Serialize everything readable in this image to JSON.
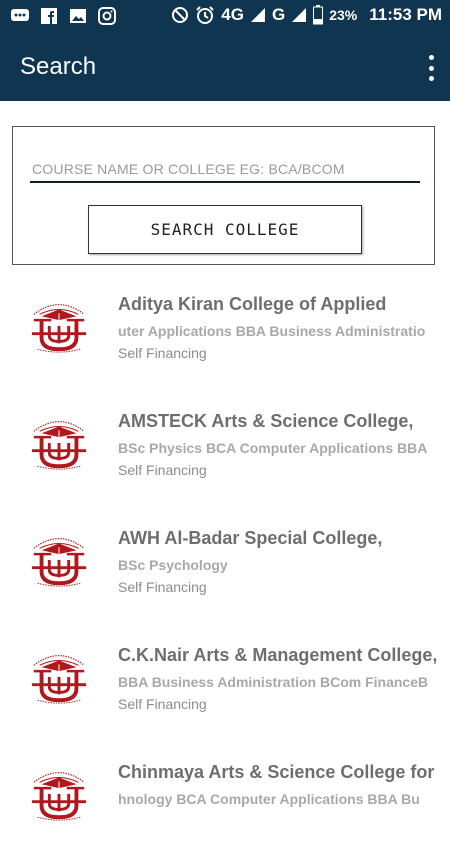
{
  "status_bar": {
    "battery": "23%",
    "time": "11:53 PM",
    "network1": "4G",
    "network2": "G",
    "icons": [
      "messages-icon",
      "facebook-icon",
      "gallery-icon",
      "instagram-icon",
      "do-not-disturb-icon",
      "alarm-icon",
      "signal-icon",
      "battery-icon"
    ]
  },
  "app_bar": {
    "title": "Search",
    "menu_icon": "overflow-menu-icon"
  },
  "search": {
    "placeholder": "COURSE NAME OR COLLEGE EG: BCA/BCOM",
    "button_label": "SEARCH COLLEGE"
  },
  "colors": {
    "primary": "#0f3550",
    "logo_red": "#b0181e"
  },
  "colleges": [
    {
      "name": "Aditya Kiran College of Applied",
      "courses": "uter Applications BBA Business Administratio",
      "type": "Self Financing"
    },
    {
      "name": "AMSTECK Arts & Science College,",
      "courses": "BSc Physics BCA Computer Applications BBA",
      "type": "Self Financing"
    },
    {
      "name": "AWH Al-Badar Special  College,",
      "courses": "BSc Psychology",
      "type": "Self Financing"
    },
    {
      "name": "C.K.Nair Arts & Management College,",
      "courses": "BBA Business Administration BCom FinanceB",
      "type": "Self Financing"
    },
    {
      "name": "Chinmaya Arts & Science College for",
      "courses": "hnology BCA Computer Applications BBA Bu",
      "type": ""
    }
  ]
}
